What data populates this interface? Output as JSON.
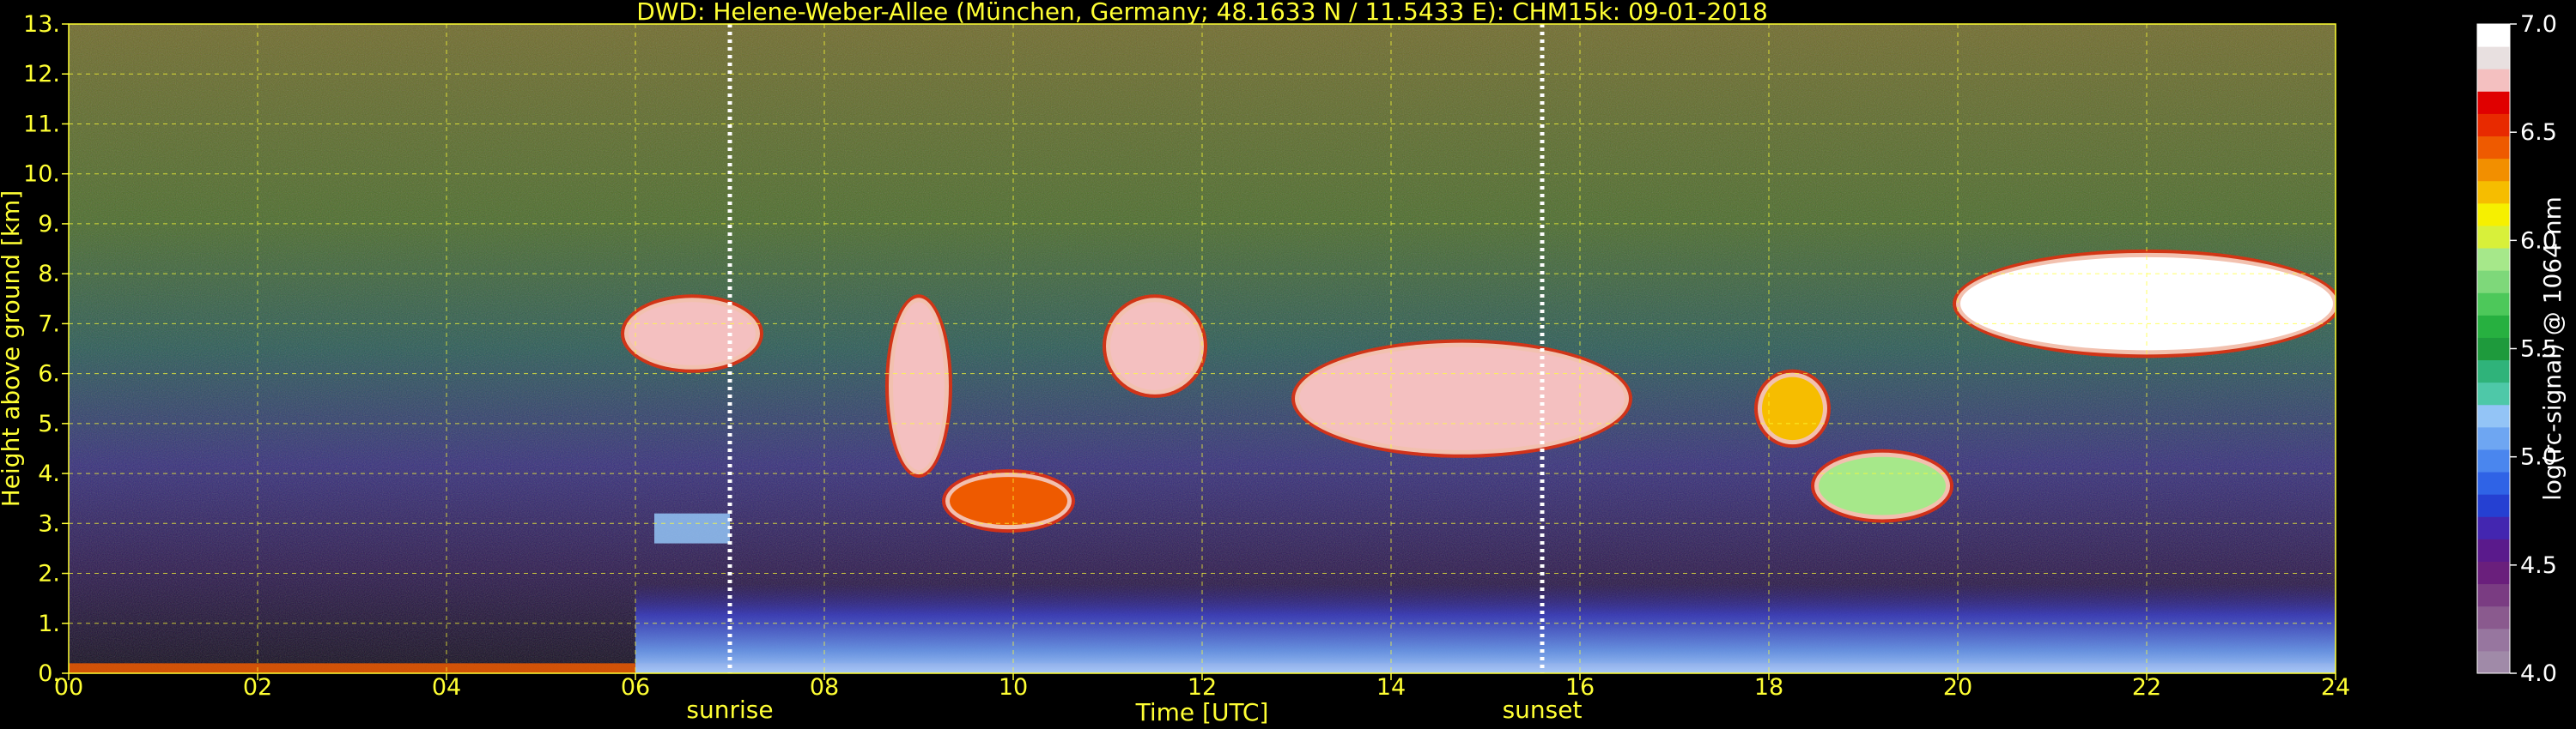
{
  "title": "DWD: Helene-Weber-Allee (München, Germany; 48.1633 N / 11.5433 E):    CHM15k: 09-01-2018",
  "colors": {
    "background": "#000000",
    "text_axis": "#ffff33",
    "text_colorbar": "#ffffff",
    "grid": "#ffff33",
    "event_line": "#ffffff"
  },
  "chart_data": {
    "type": "heatmap",
    "title": "DWD: Helene-Weber-Allee (München, Germany; 48.1633 N / 11.5433 E):    CHM15k: 09-01-2018",
    "xlabel": "Time [UTC]",
    "ylabel": "Height above ground [km]",
    "xlim": [
      0,
      24
    ],
    "ylim": [
      0,
      13
    ],
    "x_ticks": [
      "00",
      "02",
      "04",
      "06",
      "08",
      "10",
      "12",
      "14",
      "16",
      "18",
      "20",
      "22",
      "24"
    ],
    "y_ticks": [
      "0.",
      "1.",
      "2.",
      "3.",
      "4.",
      "5.",
      "6.",
      "7.",
      "8.",
      "9.",
      "10.",
      "11.",
      "12.",
      "13."
    ],
    "grid": true,
    "events": [
      {
        "label": "sunrise",
        "time_utc": 7.0
      },
      {
        "label": "sunset",
        "time_utc": 15.6
      }
    ],
    "colorbar": {
      "label": "log(rc-signal) @ 1064 nm",
      "range": [
        4.0,
        7.0
      ],
      "ticks": [
        "4.0",
        "4.5",
        "5.0",
        "5.5",
        "6.0",
        "6.5",
        "7.0"
      ],
      "colors": [
        "#a08aa8",
        "#97769f",
        "#8a5a8e",
        "#7a3c82",
        "#6a1f7c",
        "#5a1a8c",
        "#4326b0",
        "#2540d2",
        "#2f63e6",
        "#4a86ee",
        "#6ea6f2",
        "#93c4f6",
        "#4ec8a8",
        "#2fb37a",
        "#1e9a3c",
        "#27b040",
        "#4dc85a",
        "#7ed87a",
        "#a6e88a",
        "#d8f03a",
        "#f6f000",
        "#f6bd00",
        "#f28f00",
        "#ee5a00",
        "#e82a00",
        "#e00000",
        "#f4c0c0",
        "#e8e0e0",
        "#ffffff"
      ]
    },
    "features": [
      {
        "type": "aerosol_layer",
        "start": 0.0,
        "end": 24.0,
        "base_km": 0.0,
        "top_km": 0.2,
        "level": 6.5
      },
      {
        "type": "boundary_layer",
        "start": 6.0,
        "end": 24.0,
        "base_km": 0.0,
        "top_km": 1.8,
        "level": 4.9
      },
      {
        "type": "aerosol_layer",
        "start": 6.2,
        "end": 7.0,
        "base_km": 2.6,
        "top_km": 3.2,
        "level": 5.2
      },
      {
        "type": "cloud",
        "start": 5.9,
        "end": 7.3,
        "base_km": 6.1,
        "top_km": 7.5,
        "level": 6.8
      },
      {
        "type": "cloud",
        "start": 8.7,
        "end": 9.3,
        "base_km": 4.0,
        "top_km": 7.5,
        "level": 6.8
      },
      {
        "type": "cloud",
        "start": 9.3,
        "end": 10.6,
        "base_km": 2.9,
        "top_km": 4.0,
        "level": 6.5
      },
      {
        "type": "cloud",
        "start": 11.0,
        "end": 12.0,
        "base_km": 5.6,
        "top_km": 7.5,
        "level": 6.8
      },
      {
        "type": "cloud",
        "start": 13.0,
        "end": 16.5,
        "base_km": 4.4,
        "top_km": 6.6,
        "level": 6.8
      },
      {
        "type": "cloud",
        "start": 17.9,
        "end": 18.6,
        "base_km": 4.6,
        "top_km": 6.0,
        "level": 6.3
      },
      {
        "type": "cloud",
        "start": 18.5,
        "end": 19.9,
        "base_km": 3.1,
        "top_km": 4.4,
        "level": 5.9
      },
      {
        "type": "cloud",
        "start": 20.0,
        "end": 24.0,
        "base_km": 6.4,
        "top_km": 8.4,
        "level": 7.0
      }
    ]
  }
}
